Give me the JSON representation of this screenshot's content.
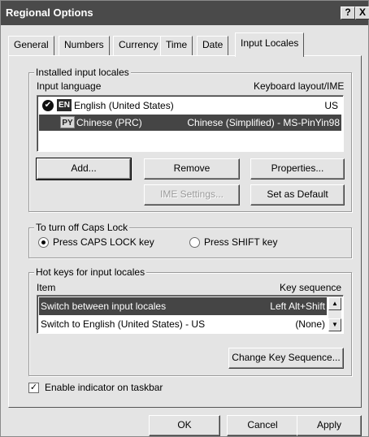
{
  "window": {
    "title": "Regional Options",
    "help_glyph": "?",
    "close_glyph": "X"
  },
  "tabs": [
    {
      "label": "General"
    },
    {
      "label": "Numbers"
    },
    {
      "label": "Currency"
    },
    {
      "label": "Time"
    },
    {
      "label": "Date"
    },
    {
      "label": "Input Locales"
    }
  ],
  "installed": {
    "legend": "Installed input locales",
    "col_language": "Input language",
    "col_layout": "Keyboard layout/IME",
    "rows": [
      {
        "badge": "EN",
        "language": "English (United States)",
        "layout": "US",
        "default_mark": "✔",
        "selected": false
      },
      {
        "badge": "PY",
        "language": "Chinese (PRC)",
        "layout": "Chinese (Simplified) - MS-PinYin98",
        "selected": true
      }
    ],
    "buttons": {
      "add": "Add...",
      "remove": "Remove",
      "properties": "Properties...",
      "ime_settings": "IME Settings...",
      "set_default": "Set as Default"
    }
  },
  "caps": {
    "legend": "To turn off Caps Lock",
    "option_caps": "Press CAPS LOCK key",
    "option_shift": "Press SHIFT key",
    "selected": "caps"
  },
  "hotkeys": {
    "legend": "Hot keys for input locales",
    "col_item": "Item",
    "col_sequence": "Key sequence",
    "rows": [
      {
        "item": "Switch between input locales",
        "sequence": "Left Alt+Shift",
        "selected": true
      },
      {
        "item": "Switch to English (United States) - US",
        "sequence": "(None)",
        "selected": false
      }
    ],
    "change_button": "Change Key Sequence..."
  },
  "indicator": {
    "label": "Enable indicator on taskbar",
    "checked": true
  },
  "footer": {
    "ok": "OK",
    "cancel": "Cancel",
    "apply": "Apply"
  }
}
